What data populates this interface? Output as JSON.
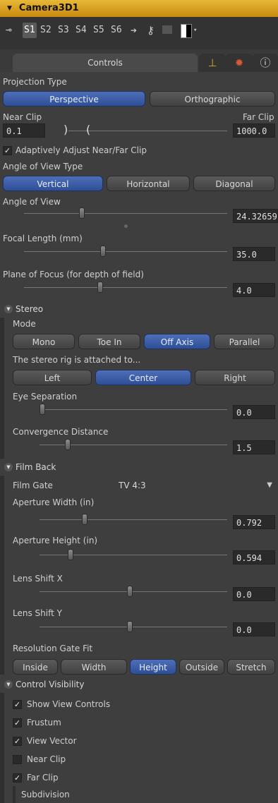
{
  "header": {
    "title": "Camera3D1"
  },
  "toolbar": {
    "slots": [
      "S1",
      "S2",
      "S3",
      "S4",
      "S5",
      "S6"
    ]
  },
  "tabs": {
    "controls_label": "Controls"
  },
  "projection": {
    "label": "Projection Type",
    "options": [
      "Perspective",
      "Orthographic"
    ],
    "selected": "Perspective"
  },
  "clip": {
    "near_label": "Near Clip",
    "far_label": "Far Clip",
    "near_value": "0.1",
    "far_value": "1000.0",
    "adaptive_label": "Adaptively Adjust Near/Far Clip"
  },
  "aov_type": {
    "label": "Angle of View Type",
    "options": [
      "Vertical",
      "Horizontal",
      "Diagonal"
    ],
    "selected": "Vertical"
  },
  "aov": {
    "label": "Angle of View",
    "value": "24.32659"
  },
  "focal": {
    "label": "Focal Length (mm)",
    "value": "35.0"
  },
  "focus": {
    "label": "Plane of Focus (for depth of field)",
    "value": "4.0"
  },
  "stereo": {
    "title": "Stereo",
    "mode_label": "Mode",
    "modes": [
      "Mono",
      "Toe In",
      "Off Axis",
      "Parallel"
    ],
    "selected_mode": "Off Axis",
    "rig_label": "The stereo rig is attached to...",
    "rig_options": [
      "Left",
      "Center",
      "Right"
    ],
    "selected_rig": "Center",
    "eye_sep_label": "Eye Separation",
    "eye_sep_value": "0.0",
    "conv_label": "Convergence Distance",
    "conv_value": "1.5"
  },
  "film_back": {
    "title": "Film Back",
    "gate_label": "Film Gate",
    "gate_value": "TV 4:3",
    "ap_width_label": "Aperture Width (in)",
    "ap_width_value": "0.792",
    "ap_height_label": "Aperture Height (in)",
    "ap_height_value": "0.594",
    "shift_x_label": "Lens Shift X",
    "shift_x_value": "0.0",
    "shift_y_label": "Lens Shift Y",
    "shift_y_value": "0.0",
    "fit_label": "Resolution Gate Fit",
    "fit_options": [
      "Inside",
      "Width",
      "Height",
      "Outside",
      "Stretch"
    ],
    "selected_fit": "Height"
  },
  "visibility": {
    "title": "Control Visibility",
    "items": [
      {
        "label": "Show View Controls",
        "checked": true
      },
      {
        "label": "Frustum",
        "checked": true
      },
      {
        "label": "View Vector",
        "checked": true
      },
      {
        "label": "Near Clip",
        "checked": false
      },
      {
        "label": "Far Clip",
        "checked": true
      }
    ],
    "subdivision_label": "Subdivision"
  },
  "colors": {
    "accent": "#2e4f96",
    "header": "#d9a020"
  }
}
